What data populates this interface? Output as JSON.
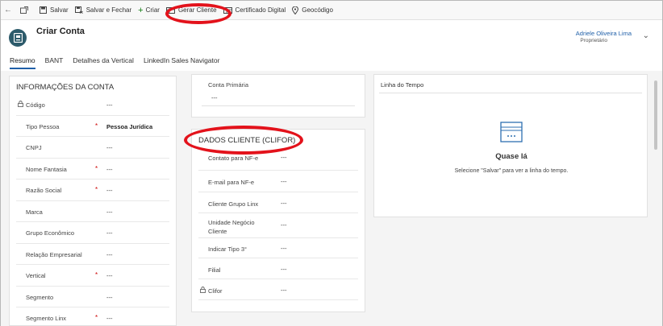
{
  "toolbar": {
    "save_label": "Salvar",
    "save_close_label": "Salvar e Fechar",
    "new_label": "Criar",
    "generate_client_label": "Gerar Cliente",
    "certificate_label": "Certificado Digital",
    "geocode_label": "Geocódigo"
  },
  "header": {
    "title": "Criar Conta",
    "owner_name": "Adriele Oliveira Lima",
    "owner_role": "Proprietário"
  },
  "tabs": [
    {
      "label": "Resumo"
    },
    {
      "label": "BANT"
    },
    {
      "label": "Detalhes da Vertical"
    },
    {
      "label": "LinkedIn Sales Navigator"
    }
  ],
  "account_info": {
    "title": "INFORMAÇÕES DA CONTA",
    "fields": [
      {
        "label": "Código",
        "value": "---",
        "required": "",
        "locked": true
      },
      {
        "label": "Tipo Pessoa",
        "value": "Pessoa Jurídica",
        "required": "*",
        "locked": false
      },
      {
        "label": "CNPJ",
        "value": "---",
        "required": "",
        "locked": false
      },
      {
        "label": "Nome Fantasia",
        "value": "---",
        "required": "*",
        "locked": false
      },
      {
        "label": "Razão Social",
        "value": "---",
        "required": "*",
        "locked": false
      },
      {
        "label": "Marca",
        "value": "---",
        "required": "",
        "locked": false
      },
      {
        "label": "Grupo Econômico",
        "value": "---",
        "required": "",
        "locked": false
      },
      {
        "label": "Relação Empresarial",
        "value": "---",
        "required": "",
        "locked": false
      },
      {
        "label": "Vertical",
        "value": "---",
        "required": "*",
        "locked": false
      },
      {
        "label": "Segmento",
        "value": "---",
        "required": "",
        "locked": false
      },
      {
        "label": "Segmento Linx",
        "value": "---",
        "required": "*",
        "locked": false
      }
    ]
  },
  "primary_contact": {
    "label": "Conta Primária",
    "value": "---"
  },
  "client_data": {
    "title": "DADOS CLIENTE (CLIFOR)",
    "fields": [
      {
        "label": "Contato para NF-e",
        "value": "---"
      },
      {
        "label": "E-mail para NF-e",
        "value": "---"
      },
      {
        "label": "Cliente Grupo Linx",
        "value": "---"
      },
      {
        "label": "Unidade Negócio Cliente",
        "value": "---"
      },
      {
        "label": "Indicar Tipo 3°",
        "value": "---"
      },
      {
        "label": "Filial",
        "value": "---"
      },
      {
        "label": "Clifor",
        "value": "---"
      }
    ]
  },
  "timeline": {
    "title": "Linha do Tempo",
    "heading": "Quase lá",
    "message": "Selecione \"Salvar\" para ver a linha do tempo."
  },
  "colors": {
    "accent": "#1f5fa8",
    "entity_icon": "#2d5b6b",
    "annotation": "#e3121b",
    "required": "#cc0000"
  }
}
